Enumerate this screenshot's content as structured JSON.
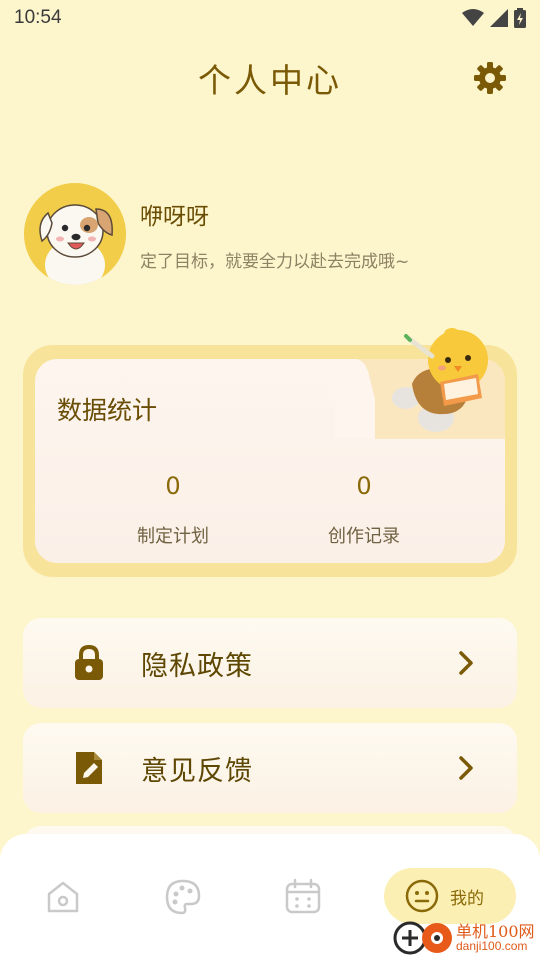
{
  "status_bar": {
    "time": "10:54"
  },
  "header": {
    "title": "个人中心"
  },
  "profile": {
    "name": "咿呀呀",
    "bio": "定了目标，就要全力以赴去完成哦~"
  },
  "stats": {
    "title": "数据统计",
    "items": [
      {
        "value": "0",
        "label": "制定计划"
      },
      {
        "value": "0",
        "label": "创作记录"
      }
    ]
  },
  "menu": [
    {
      "label": "隐私政策",
      "icon": "lock-icon"
    },
    {
      "label": "意见反馈",
      "icon": "edit-document-icon"
    }
  ],
  "tabbar": {
    "items": [
      {
        "icon": "home-icon"
      },
      {
        "icon": "palette-icon"
      },
      {
        "icon": "calendar-icon"
      },
      {
        "icon": "face-icon",
        "label": "我的",
        "active": true
      }
    ]
  },
  "watermark": {
    "cn": "单机100网",
    "en": "danji100.com"
  },
  "colors": {
    "background": "#fdf6cd",
    "accent": "#7a5a06",
    "card": "#f8e39b",
    "tab_active": "#fbefb3"
  }
}
